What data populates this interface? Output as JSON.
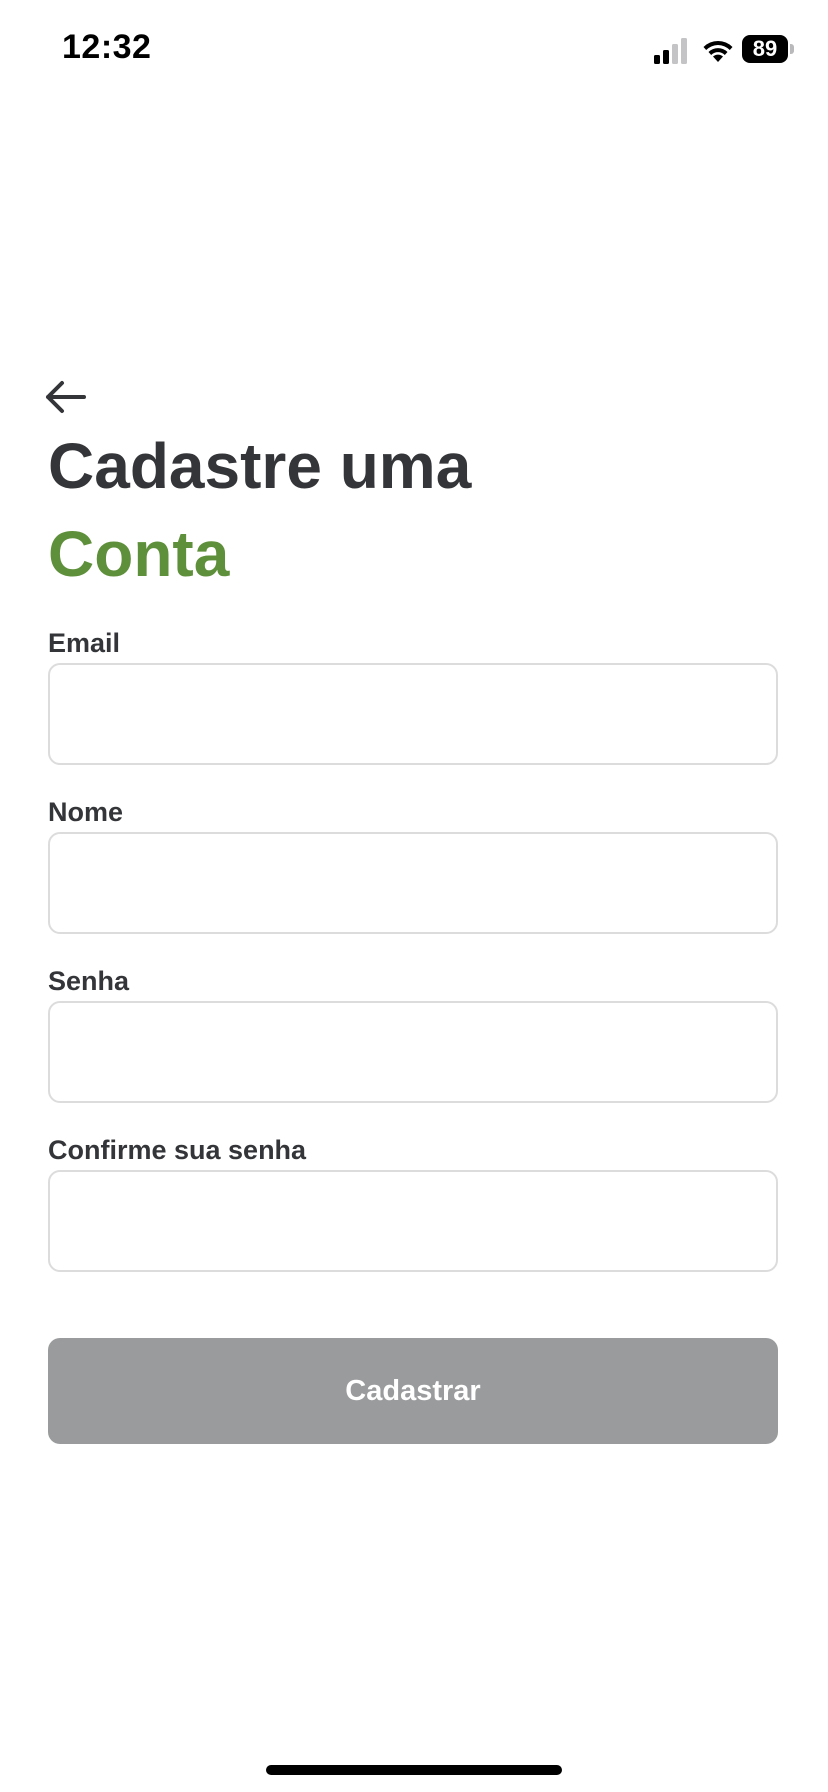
{
  "status_bar": {
    "time": "12:32",
    "battery_level": "89",
    "signal_icon": "cellular-signal-icon",
    "wifi_icon": "wifi-icon"
  },
  "header": {
    "back_icon": "arrow-left-icon",
    "title_line1": "Cadastre uma",
    "title_line2": "Conta",
    "title_accent_color": "#5e8f3a"
  },
  "form": {
    "email": {
      "label": "Email",
      "value": "",
      "placeholder": ""
    },
    "name": {
      "label": "Nome",
      "value": "",
      "placeholder": ""
    },
    "password": {
      "label": "Senha",
      "value": "",
      "placeholder": ""
    },
    "confirm_password": {
      "label": "Confirme sua senha",
      "value": "",
      "placeholder": ""
    },
    "submit_label": "Cadastrar",
    "submit_color": "#9a9b9c"
  }
}
